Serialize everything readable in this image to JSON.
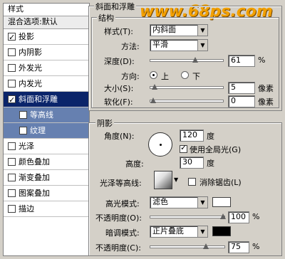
{
  "left_panel": {
    "header": "样式",
    "blend_options": "混合选项:默认",
    "items": [
      {
        "label": "投影",
        "checked": true
      },
      {
        "label": "内阴影",
        "checked": false
      },
      {
        "label": "外发光",
        "checked": false
      },
      {
        "label": "内发光",
        "checked": false
      },
      {
        "label": "斜面和浮雕",
        "checked": true,
        "selected": true
      },
      {
        "label": "等高线",
        "checked": false,
        "sub": true
      },
      {
        "label": "纹理",
        "checked": false,
        "sub": true
      },
      {
        "label": "光泽",
        "checked": false
      },
      {
        "label": "颜色叠加",
        "checked": false
      },
      {
        "label": "渐变叠加",
        "checked": false
      },
      {
        "label": "图案叠加",
        "checked": false
      },
      {
        "label": "描边",
        "checked": false
      }
    ]
  },
  "watermark": "www.68ps.com",
  "bevel": {
    "group_title": "斜面和浮雕",
    "structure_title": "结构",
    "style_label": "样式(T):",
    "style_value": "内斜面",
    "method_label": "方法:",
    "method_value": "平滑",
    "depth_label": "深度(D):",
    "depth_value": "61",
    "depth_unit": "%",
    "depth_level": 0.61,
    "direction_label": "方向:",
    "dir_up": "上",
    "dir_down": "下",
    "size_label": "大小(S):",
    "size_value": "5",
    "size_unit": "像素",
    "size_level": 0.02,
    "soften_label": "软化(F):",
    "soften_value": "0",
    "soften_unit": "像素",
    "soften_level": 0.0
  },
  "shading": {
    "title": "阴影",
    "angle_label": "角度(N):",
    "angle_value": "120",
    "angle_unit": "度",
    "global_light_label": "使用全局光(G)",
    "global_light_checked": true,
    "altitude_label": "高度:",
    "altitude_value": "30",
    "altitude_unit": "度",
    "gloss_contour_label": "光泽等高线:",
    "anti_alias_label": "消除锯齿(L)",
    "highlight_mode_label": "高光模式:",
    "highlight_mode_value": "滤色",
    "highlight_color": "#ffffff",
    "highlight_opacity_label": "不透明度(O):",
    "highlight_opacity_value": "100",
    "highlight_opacity_level": 1.0,
    "shadow_mode_label": "暗调模式:",
    "shadow_mode_value": "正片叠底",
    "shadow_color": "#000000",
    "shadow_opacity_label": "不透明度(C):",
    "shadow_opacity_value": "75",
    "shadow_opacity_level": 0.75,
    "percent": "%"
  }
}
